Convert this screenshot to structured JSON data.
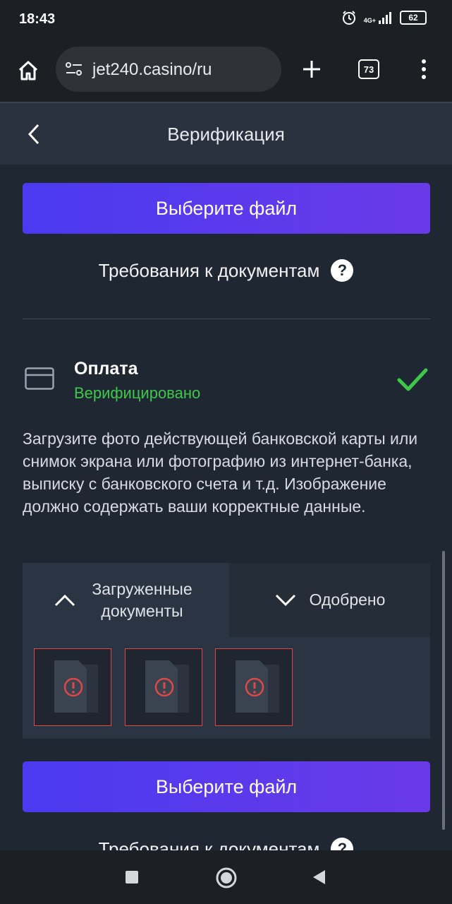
{
  "status_bar": {
    "time": "18:43",
    "network": "4G+",
    "battery": "62"
  },
  "browser": {
    "url": "jet240.casino/ru",
    "tab_count": "73"
  },
  "header": {
    "title": "Верификация"
  },
  "upload_button_1": "Выберите файл",
  "requirements_1": "Требования к документам",
  "payment": {
    "title": "Оплата",
    "status": "Верифицировано",
    "status_color": "#3ec74a",
    "description": "Загрузите фото действующей банковской карты или снимок экрана или фотографию из интернет-банка, выписку с банковского счета и т.д. Изображение должно содержать ваши корректные данные."
  },
  "tabs": {
    "uploaded": {
      "line1": "Загруженные",
      "line2": "документы"
    },
    "approved": "Одобрено"
  },
  "documents": [
    {
      "icon": "document-error-icon"
    },
    {
      "icon": "document-error-icon"
    },
    {
      "icon": "document-error-icon"
    }
  ],
  "upload_button_2": "Выберите файл",
  "requirements_2": "Требования к документам",
  "colors": {
    "accent_start": "#4a3af0",
    "accent_end": "#6a3ae8",
    "error": "#e04848",
    "success": "#3ec74a"
  }
}
